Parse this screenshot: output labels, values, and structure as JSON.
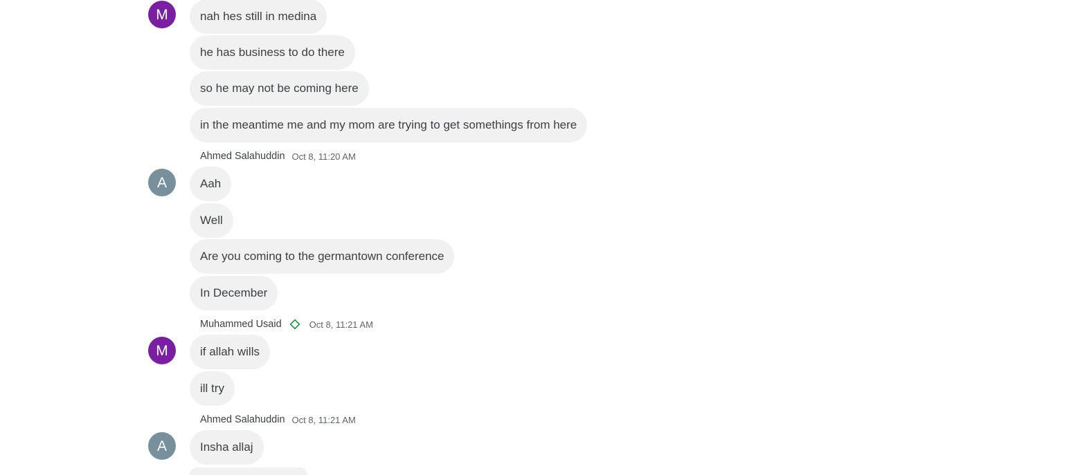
{
  "chat": {
    "groups": [
      {
        "avatar_letter": "M",
        "messages": [
          "nah hes still in medina",
          "he has business to do there",
          "so he may not be coming here",
          "in the meantime me and my mom are trying to get somethings from here"
        ]
      },
      {
        "sender": "Ahmed Salahuddin",
        "time": "Oct 8, 11:20 AM",
        "avatar_letter": "A",
        "messages": [
          "Aah",
          "Well",
          "Are you coming to the germantown conference",
          "In December"
        ]
      },
      {
        "sender": "Muhammed Usaid",
        "time": "Oct 8, 11:21 AM",
        "badge_icon": "diamond-icon",
        "avatar_letter": "M",
        "messages": [
          "if allah wills",
          "ill try"
        ]
      },
      {
        "sender": "Ahmed Salahuddin",
        "time": "Oct 8, 11:21 AM",
        "avatar_letter": "A",
        "messages": [
          "Insha allaj",
          ""
        ]
      }
    ]
  },
  "colors": {
    "avatar_purple": "#7b1fa2",
    "avatar_grey": "#78909c",
    "bubble_bg": "#f1f1f1",
    "badge_green": "#1e8e3e"
  }
}
